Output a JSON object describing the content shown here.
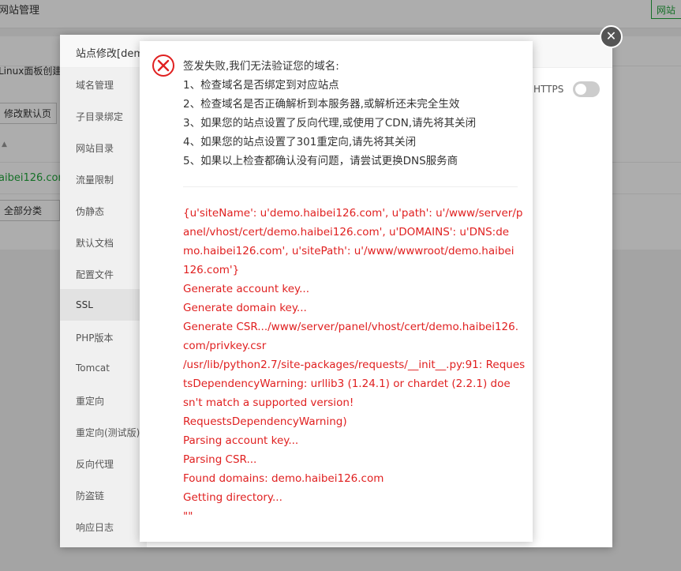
{
  "background": {
    "title": "网站管理",
    "corner_button": "网站",
    "linux_label": "Linux面板创建",
    "edit_default_page_button": "修改默认页",
    "domain_link": "aibei126.com",
    "category_select": "全部分类"
  },
  "site_dialog": {
    "title": "站点修改[dem",
    "https_label": "HTTPS",
    "close_symbol": "✕",
    "side_items": [
      {
        "label": "域名管理",
        "active": false
      },
      {
        "label": "子目录绑定",
        "active": false
      },
      {
        "label": "网站目录",
        "active": false
      },
      {
        "label": "流量限制",
        "active": false
      },
      {
        "label": "伪静态",
        "active": false
      },
      {
        "label": "默认文档",
        "active": false
      },
      {
        "label": "配置文件",
        "active": false
      },
      {
        "label": "SSL",
        "active": true
      },
      {
        "label": "PHP版本",
        "active": false
      },
      {
        "label": "Tomcat",
        "active": false
      },
      {
        "label": "重定向",
        "active": false
      },
      {
        "label": "重定向(测试版)",
        "active": false
      },
      {
        "label": "反向代理",
        "active": false
      },
      {
        "label": "防盗链",
        "active": false
      },
      {
        "label": "响应日志",
        "active": false
      }
    ]
  },
  "message": {
    "icon": "error-circle-icon",
    "lines": [
      "签发失败,我们无法验证您的域名:",
      "1、检查域名是否绑定到对应站点",
      "2、检查域名是否正确解析到本服务器,或解析还未完全生效",
      "3、如果您的站点设置了反向代理,或使用了CDN,请先将其关闭",
      "4、如果您的站点设置了301重定向,请先将其关闭",
      "5、如果以上检查都确认没有问题，请尝试更换DNS服务商"
    ],
    "log_lines": [
      "{u'siteName': u'demo.haibei126.com', u'path': u'/www/server/p",
      "anel/vhost/cert/demo.haibei126.com', u'DOMAINS': u'DNS:de",
      "mo.haibei126.com', u'sitePath': u'/www/wwwroot/demo.haibei",
      "126.com'}",
      "Generate account key...",
      "Generate domain key...",
      "Generate CSR.../www/server/panel/vhost/cert/demo.haibei126.",
      "com/privkey.csr",
      "/usr/lib/python2.7/site-packages/requests/__init__.py:91: Reques",
      "tsDependencyWarning: urllib3 (1.24.1) or chardet (2.2.1) doe",
      "sn't match a supported version!",
      "RequestsDependencyWarning)",
      "Parsing account key...",
      "Parsing CSR...",
      "Found domains: demo.haibei126.com",
      "Getting directory...",
      "\"\""
    ]
  },
  "colors": {
    "error_red": "#e02020",
    "accent_green": "#20a53a"
  }
}
